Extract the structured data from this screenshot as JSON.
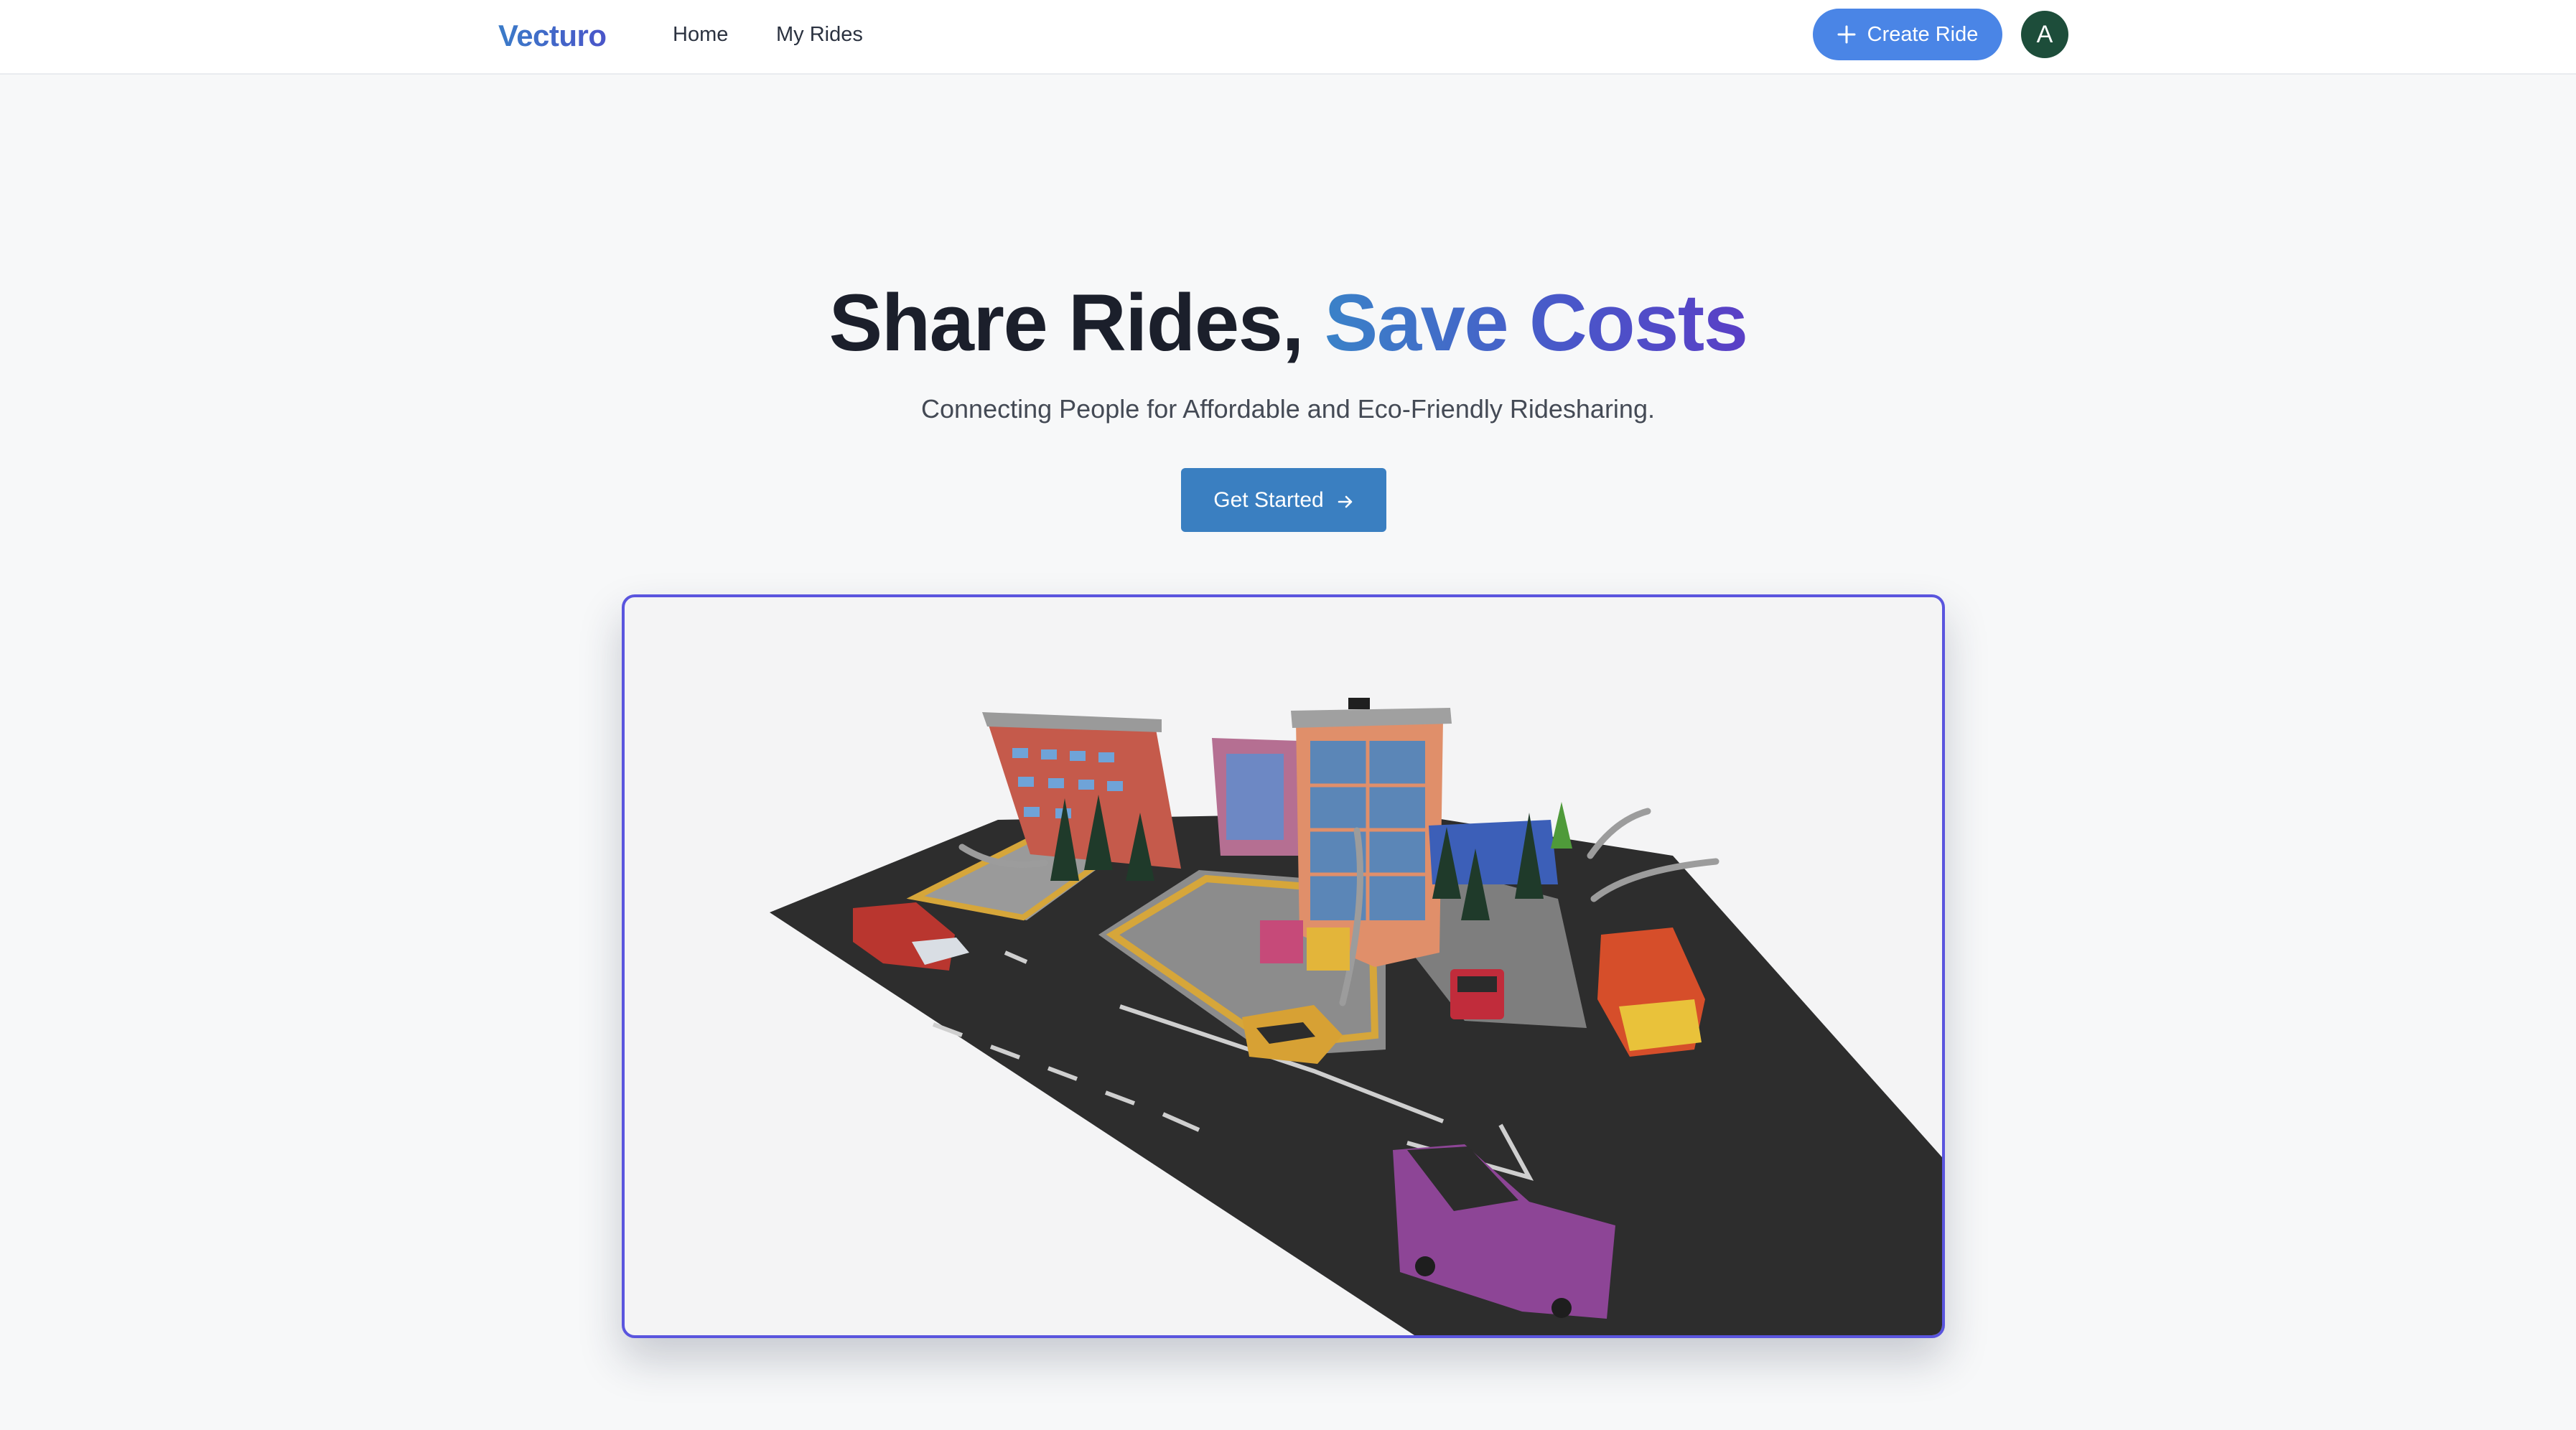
{
  "nav": {
    "brand": "Vecturo",
    "links": [
      "Home",
      "My Rides"
    ],
    "create_label": "Create Ride",
    "avatar_initial": "A"
  },
  "hero": {
    "title_main": "Share Rides, ",
    "title_accent": "Save Costs",
    "subtitle": "Connecting People for Affordable and Eco-Friendly Ridesharing.",
    "cta_label": "Get Started"
  },
  "colors": {
    "brand_gradient": [
      "#3a7bc8",
      "#4a55c9"
    ],
    "create_button": "#4a85e6",
    "cta_button": "#3a7fc1",
    "avatar_bg": "#1d4d3a",
    "card_border": "#5a55de"
  },
  "icons": {
    "create": "plus-icon",
    "cta": "arrow-right-icon"
  }
}
